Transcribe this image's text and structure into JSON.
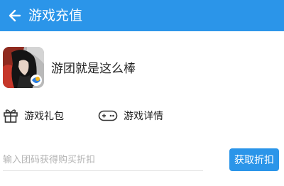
{
  "header": {
    "back_icon": "arrow-left-icon",
    "title": "游戏充值",
    "background_color": "#2b95e9"
  },
  "game": {
    "title": "游团就是这么棒",
    "icon": "game-cover-icon"
  },
  "actions": [
    {
      "label": "游戏礼包",
      "icon": "gift-icon"
    },
    {
      "label": "游戏详情",
      "icon": "gamepad-icon"
    }
  ],
  "coupon": {
    "placeholder": "输入团码获得购买折扣",
    "value": "",
    "button_label": "获取折扣"
  }
}
